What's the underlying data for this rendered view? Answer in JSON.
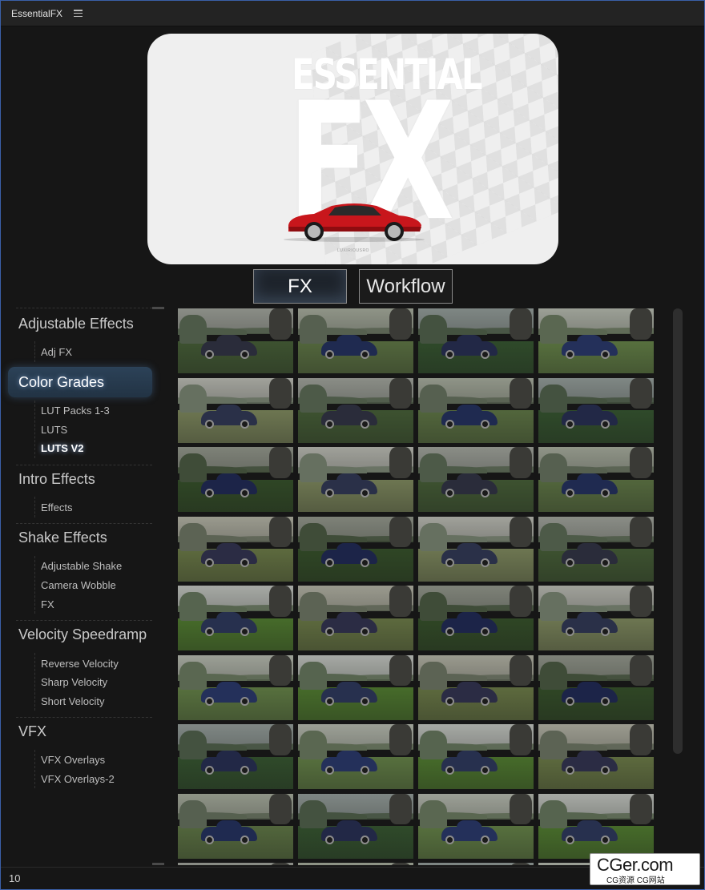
{
  "panel": {
    "title": "EssentialFX",
    "menu_icon": "hamburger-menu-icon"
  },
  "banner": {
    "line1": "ESSENTIAL",
    "line2": "FX",
    "caption": "LUXIRIOUSRO"
  },
  "tabs": [
    {
      "label": "FX",
      "active": true
    },
    {
      "label": "Workflow",
      "active": false
    }
  ],
  "sidebar": {
    "sections": [
      {
        "title": "Adjustable Effects",
        "items": [
          "Adj FX"
        ]
      },
      {
        "title": "Color Grades",
        "active": true,
        "items": [
          "LUT Packs 1-3",
          "LUTS",
          "LUTS V2"
        ],
        "active_item": "LUTS V2"
      },
      {
        "title": "Intro Effects",
        "items": [
          "Effects"
        ]
      },
      {
        "title": "Shake Effects",
        "items": [
          "Adjustable Shake",
          "Camera Wobble",
          "FX"
        ]
      },
      {
        "title": "Velocity Speedramp",
        "items": [
          "Reverse Velocity",
          "Sharp Velocity",
          "Short Velocity"
        ]
      },
      {
        "title": "VFX",
        "items": [
          "VFX Overlays",
          "VFX Overlays-2"
        ]
      }
    ]
  },
  "grid": {
    "columns": 4,
    "rows_visible": 8,
    "thumbnail_subject": "blue car on grass field LUT preview"
  },
  "footer": {
    "count": "10"
  },
  "watermark": {
    "big": "CGer.com",
    "small": "CG资源 CG网站"
  },
  "colors": {
    "accent_active": "#2c4258",
    "background": "#161616",
    "topbar": "#232323"
  }
}
